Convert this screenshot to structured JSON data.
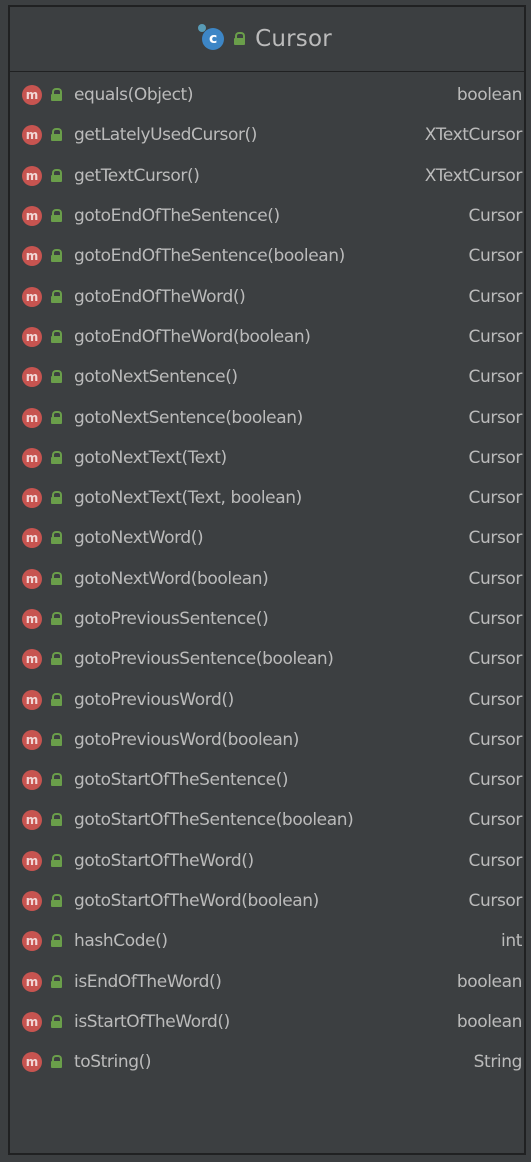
{
  "class_header": {
    "icon_letter": "c",
    "title": "Cursor"
  },
  "colors": {
    "background": "#3c3f41",
    "border": "#202122",
    "text": "#bbbbbb",
    "method_icon": "#c75450",
    "class_icon": "#3d86c6",
    "lock_icon": "#6a9e4a"
  },
  "method_icon_letter": "m",
  "methods": [
    {
      "name": "equals(Object)",
      "type": "boolean"
    },
    {
      "name": "getLatelyUsedCursor()",
      "type": "XTextCursor"
    },
    {
      "name": "getTextCursor()",
      "type": "XTextCursor"
    },
    {
      "name": "gotoEndOfTheSentence()",
      "type": "Cursor"
    },
    {
      "name": "gotoEndOfTheSentence(boolean)",
      "type": "Cursor"
    },
    {
      "name": "gotoEndOfTheWord()",
      "type": "Cursor"
    },
    {
      "name": "gotoEndOfTheWord(boolean)",
      "type": "Cursor"
    },
    {
      "name": "gotoNextSentence()",
      "type": "Cursor"
    },
    {
      "name": "gotoNextSentence(boolean)",
      "type": "Cursor"
    },
    {
      "name": "gotoNextText(Text)",
      "type": "Cursor"
    },
    {
      "name": "gotoNextText(Text, boolean)",
      "type": "Cursor"
    },
    {
      "name": "gotoNextWord()",
      "type": "Cursor"
    },
    {
      "name": "gotoNextWord(boolean)",
      "type": "Cursor"
    },
    {
      "name": "gotoPreviousSentence()",
      "type": "Cursor"
    },
    {
      "name": "gotoPreviousSentence(boolean)",
      "type": "Cursor"
    },
    {
      "name": "gotoPreviousWord()",
      "type": "Cursor"
    },
    {
      "name": "gotoPreviousWord(boolean)",
      "type": "Cursor"
    },
    {
      "name": "gotoStartOfTheSentence()",
      "type": "Cursor"
    },
    {
      "name": "gotoStartOfTheSentence(boolean)",
      "type": "Cursor"
    },
    {
      "name": "gotoStartOfTheWord()",
      "type": "Cursor"
    },
    {
      "name": "gotoStartOfTheWord(boolean)",
      "type": "Cursor"
    },
    {
      "name": "hashCode()",
      "type": "int"
    },
    {
      "name": "isEndOfTheWord()",
      "type": "boolean"
    },
    {
      "name": "isStartOfTheWord()",
      "type": "boolean"
    },
    {
      "name": "toString()",
      "type": "String"
    }
  ]
}
